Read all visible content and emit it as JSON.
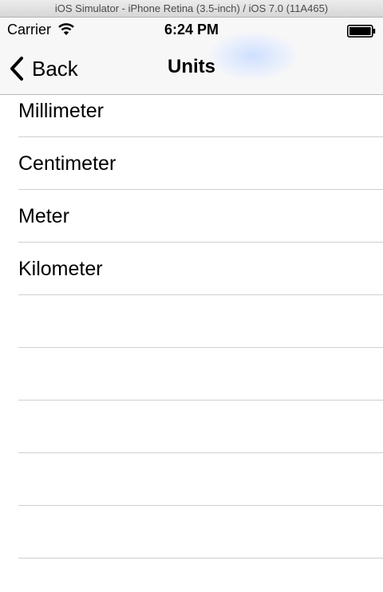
{
  "window": {
    "title": "iOS Simulator - iPhone Retina (3.5-inch) / iOS 7.0 (11A465)"
  },
  "status_bar": {
    "carrier": "Carrier",
    "time": "6:24 PM",
    "icons": [
      "wifi-icon",
      "battery-icon"
    ]
  },
  "nav": {
    "back_label": "Back",
    "back_icon": "chevron-left-icon",
    "title": "Units"
  },
  "units": {
    "items": [
      {
        "label": "Millimeter"
      },
      {
        "label": "Centimeter"
      },
      {
        "label": "Meter"
      },
      {
        "label": "Kilometer"
      },
      {
        "label": ""
      },
      {
        "label": ""
      },
      {
        "label": ""
      },
      {
        "label": ""
      },
      {
        "label": ""
      }
    ]
  },
  "colors": {
    "nav_background": "#f7f7f8",
    "separator": "#cfcfd4",
    "text": "#000000"
  }
}
